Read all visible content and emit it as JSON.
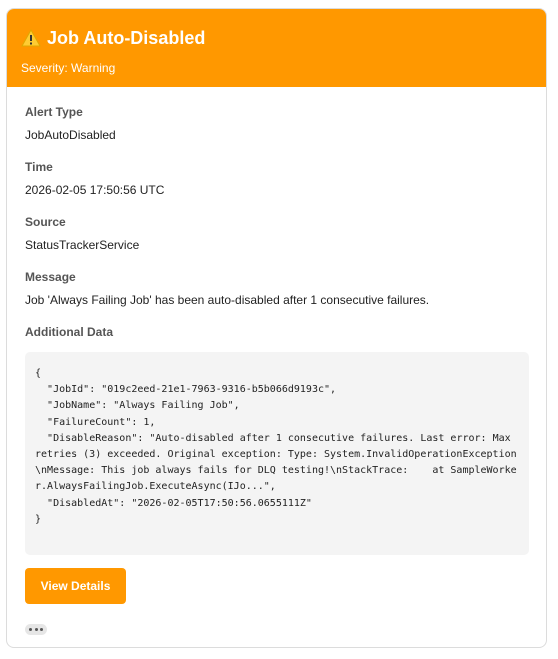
{
  "alert": {
    "title": "Job Auto-Disabled",
    "severity": "Severity: Warning",
    "header_color": "#ff9800",
    "icon": "warning-icon"
  },
  "fields": {
    "alert_type": {
      "label": "Alert Type",
      "value": "JobAutoDisabled"
    },
    "time": {
      "label": "Time",
      "value": "2026-02-05 17:50:56 UTC"
    },
    "source": {
      "label": "Source",
      "value": "StatusTrackerService"
    },
    "message": {
      "label": "Message",
      "value": "Job 'Always Failing Job' has been auto-disabled after 1 consecutive failures."
    },
    "additional_data": {
      "label": "Additional Data",
      "json_text": "{\n  \"JobId\": \"019c2eed-21e1-7963-9316-b5b066d9193c\",\n  \"JobName\": \"Always Failing Job\",\n  \"FailureCount\": 1,\n  \"DisableReason\": \"Auto-disabled after 1 consecutive failures. Last error: Max retries (3) exceeded. Original exception: Type: System.InvalidOperationException\\nMessage: This job always fails for DLQ testing!\\nStackTrace:    at SampleWorker.AlwaysFailingJob.ExecuteAsync(IJo...\",\n  \"DisabledAt\": \"2026-02-05T17:50:56.0655111Z\"\n}"
    }
  },
  "actions": {
    "view_details_label": "View Details",
    "more_icon": "ellipsis-icon"
  }
}
